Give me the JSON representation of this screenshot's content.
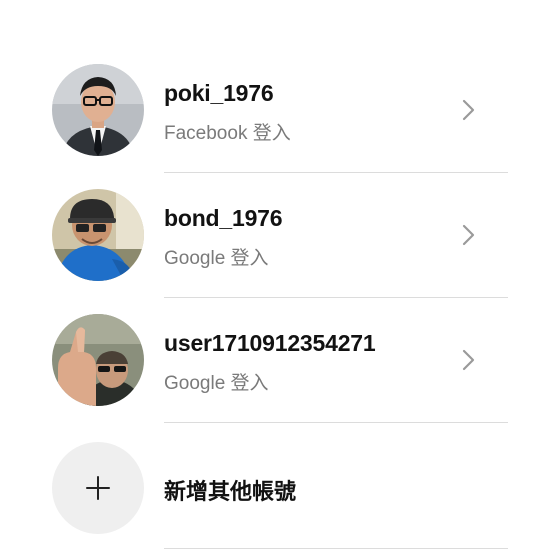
{
  "accounts": [
    {
      "username": "poki_1976",
      "login_method": "Facebook 登入"
    },
    {
      "username": "bond_1976",
      "login_method": "Google 登入"
    },
    {
      "username": "user1710912354271",
      "login_method": "Google 登入"
    }
  ],
  "add_account": {
    "label": "新增其他帳號"
  },
  "icons": {
    "chevron": "chevron-right-icon",
    "add": "plus-icon"
  },
  "colors": {
    "secondary_text": "#7a7a7a",
    "divider": "#dcdcdc",
    "add_circle_bg": "#efefef"
  }
}
